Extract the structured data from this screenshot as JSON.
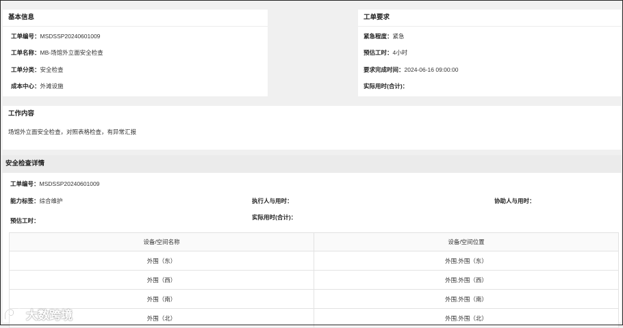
{
  "basic_info": {
    "title": "基本信息",
    "fields": [
      {
        "label": "工单编号：",
        "value": "MSDSSP20240601009"
      },
      {
        "label": "工单名称：",
        "value": "MB-场馆外立面安全检查"
      },
      {
        "label": "工单分类：",
        "value": "安全检查"
      },
      {
        "label": "成本中心：",
        "value": "外滩设施"
      }
    ]
  },
  "requirements": {
    "title": "工单要求",
    "fields": [
      {
        "label": "紧急程度：",
        "value": "紧急"
      },
      {
        "label": "预估工时：",
        "value": "4小时"
      },
      {
        "label": "要求完成时间：",
        "value": "2024-06-16 09:00:00"
      },
      {
        "label": "实际用时(合计)：",
        "value": ""
      }
    ]
  },
  "work_content": {
    "title": "工作内容",
    "text": "场馆外立面安全检查，对照表格检查，有异常汇报"
  },
  "safety_detail": {
    "title": "安全检查详情",
    "order_no_label": "工单编号：",
    "order_no": "MSDSSP20240601009",
    "skill_label": "能力标签：",
    "skill_value": "综合维护",
    "executor_label": "执行人与用时：",
    "assistant_label": "协助人与用时：",
    "est_label": "预估工时：",
    "actual_label": "实际用时(合计)：",
    "table": {
      "headers": [
        "设备/空间名称",
        "设备/空间位置"
      ],
      "rows": [
        [
          "外围（东）",
          "外围.外围（东）"
        ],
        [
          "外围（西）",
          "外围.外围（西）"
        ],
        [
          "外围（南）",
          "外围.外围（南）"
        ],
        [
          "外围（北）",
          "外围.外围（北）"
        ]
      ]
    }
  },
  "watermark": {
    "icon": "brand-logo-icon",
    "text": "大数跨境"
  }
}
